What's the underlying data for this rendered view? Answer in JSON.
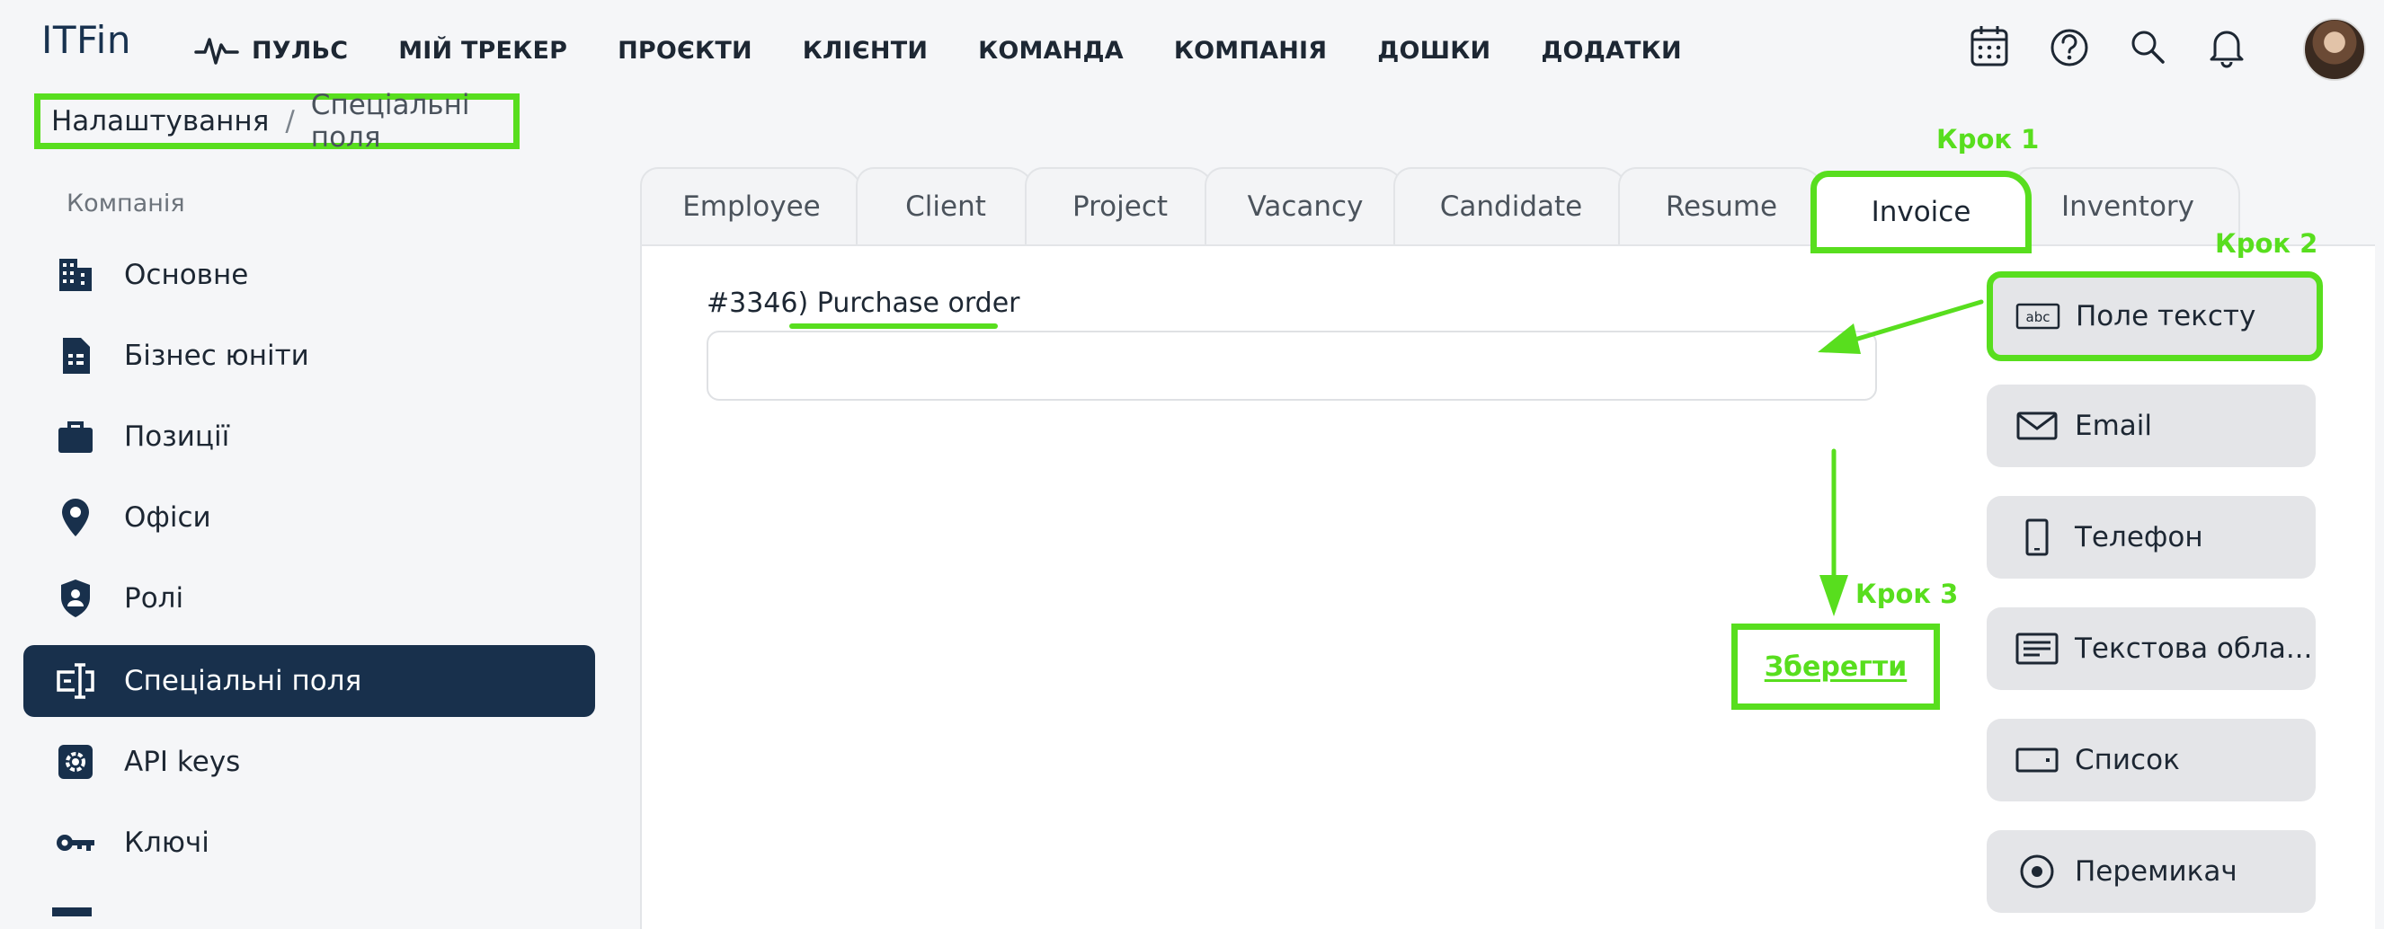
{
  "app": {
    "logo": "ITFin"
  },
  "nav": [
    {
      "label": "ПУЛЬС",
      "icon": "pulse-icon"
    },
    {
      "label": "МІЙ ТРЕКЕР"
    },
    {
      "label": "ПРОЄКТИ"
    },
    {
      "label": "КЛІЄНТИ"
    },
    {
      "label": "КОМАНДА"
    },
    {
      "label": "КОМПАНІЯ"
    },
    {
      "label": "ДОШКИ"
    },
    {
      "label": "ДОДАТКИ"
    }
  ],
  "top_icons": [
    "calendar-icon",
    "help-icon",
    "search-icon",
    "bell-icon"
  ],
  "breadcrumb": {
    "root": "Налаштування",
    "separator": "/",
    "current": "Спеціальні поля"
  },
  "sidebar": {
    "section": "Компанія",
    "items": [
      {
        "label": "Основне",
        "icon": "building-icon"
      },
      {
        "label": "Бізнес юніти",
        "icon": "document-icon"
      },
      {
        "label": "Позиції",
        "icon": "briefcase-icon"
      },
      {
        "label": "Офіси",
        "icon": "location-icon"
      },
      {
        "label": "Ролі",
        "icon": "shield-icon"
      },
      {
        "label": "Спеціальні поля",
        "icon": "text-field-icon",
        "active": true
      },
      {
        "label": "API keys",
        "icon": "gear-icon"
      },
      {
        "label": "Ключі",
        "icon": "key-icon"
      }
    ]
  },
  "tabs": [
    "Employee",
    "Client",
    "Project",
    "Vacancy",
    "Candidate",
    "Resume",
    "Invoice",
    "Inventory"
  ],
  "active_tab": "Invoice",
  "field": {
    "id": "#3346)",
    "name": "Purchase order",
    "value": ""
  },
  "save_label": "Зберегти",
  "field_types": [
    {
      "label": "Поле тексту",
      "icon": "abc-icon"
    },
    {
      "label": "Email",
      "icon": "mail-icon"
    },
    {
      "label": "Телефон",
      "icon": "phone-icon"
    },
    {
      "label": "Текстова обла...",
      "icon": "textarea-icon"
    },
    {
      "label": "Список",
      "icon": "select-icon"
    },
    {
      "label": "Перемикач",
      "icon": "radio-icon"
    }
  ],
  "annotations": {
    "step1": "Крок 1",
    "step2": "Крок 2",
    "step3": "Крок 3"
  },
  "colors": {
    "highlight": "#58de1e",
    "sidebar_active": "#18304c"
  }
}
